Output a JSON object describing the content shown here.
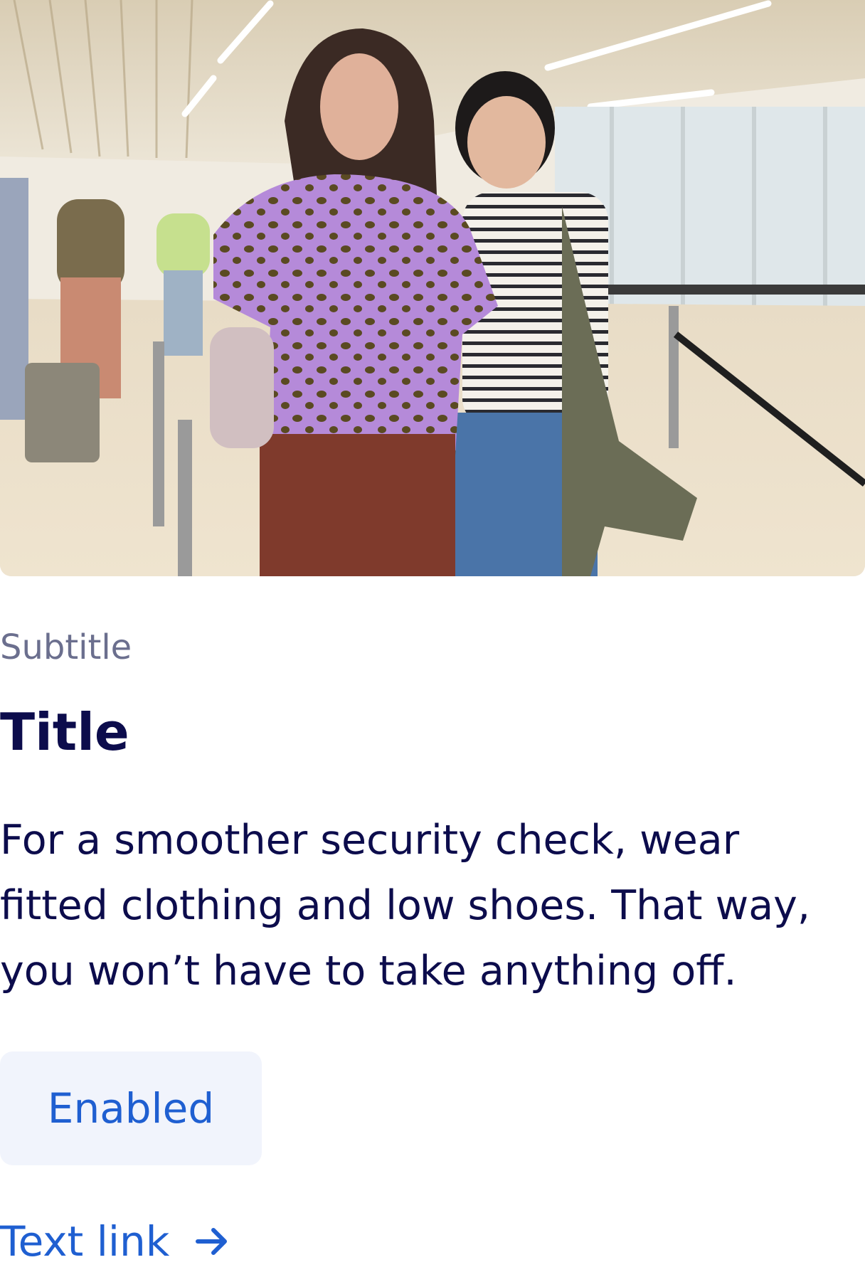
{
  "card": {
    "image_alt": "Two women walking through an airport terminal",
    "subtitle": "Subtitle",
    "title": "Title",
    "body": "For a smoother security check, wear fitted clothing and low shoes. That way, you won’t have to take anything off.",
    "button_label": "Enabled",
    "link_label": "Text link",
    "link_icon": "arrow-right-icon"
  },
  "colors": {
    "title": "#0c0c4c",
    "subtitle": "#6b6f8e",
    "accent": "#1f5fd1",
    "button_bg": "#f1f4fc"
  }
}
